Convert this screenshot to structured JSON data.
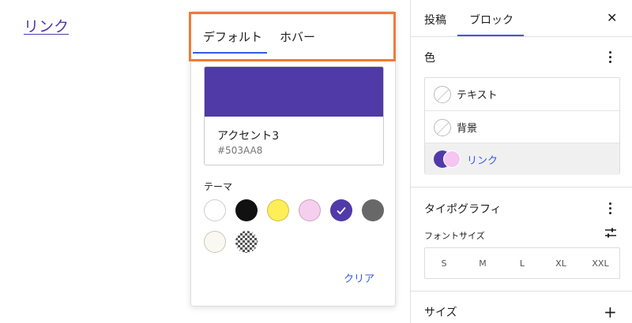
{
  "canvas": {
    "link_text": "リンク"
  },
  "popover": {
    "tabs": [
      {
        "label": "デフォルト"
      },
      {
        "label": "ホバー"
      }
    ],
    "selected_color": {
      "name": "アクセント3",
      "hex": "#503AA8"
    },
    "theme_label": "テーマ",
    "palette": [
      {
        "name": "white",
        "color": "#ffffff"
      },
      {
        "name": "black",
        "color": "#111111"
      },
      {
        "name": "yellow",
        "color": "#ffee58"
      },
      {
        "name": "pink",
        "color": "#f6cfee"
      },
      {
        "name": "accent-3",
        "color": "#503AA8",
        "selected": true
      },
      {
        "name": "gray",
        "color": "#686868"
      },
      {
        "name": "off-white",
        "color": "#f9f9f1"
      },
      {
        "name": "checker",
        "color": "pattern"
      }
    ],
    "clear_label": "クリア"
  },
  "sidebar": {
    "tabs": [
      {
        "label": "投稿"
      },
      {
        "label": "ブロック"
      }
    ],
    "close_icon": "close-icon",
    "color_section": {
      "title": "色",
      "items": [
        {
          "label": "テキスト"
        },
        {
          "label": "背景"
        },
        {
          "label": "リンク"
        }
      ]
    },
    "typography_section": {
      "title": "タイポグラフィ",
      "font_size_label": "フォントサイズ",
      "sizes": [
        "S",
        "M",
        "L",
        "XL",
        "XXL"
      ]
    },
    "size_section": {
      "title": "サイズ"
    }
  },
  "colors": {
    "accent": "#3858e9",
    "link": "#503AA8",
    "highlight_border": "#f07a3a"
  }
}
